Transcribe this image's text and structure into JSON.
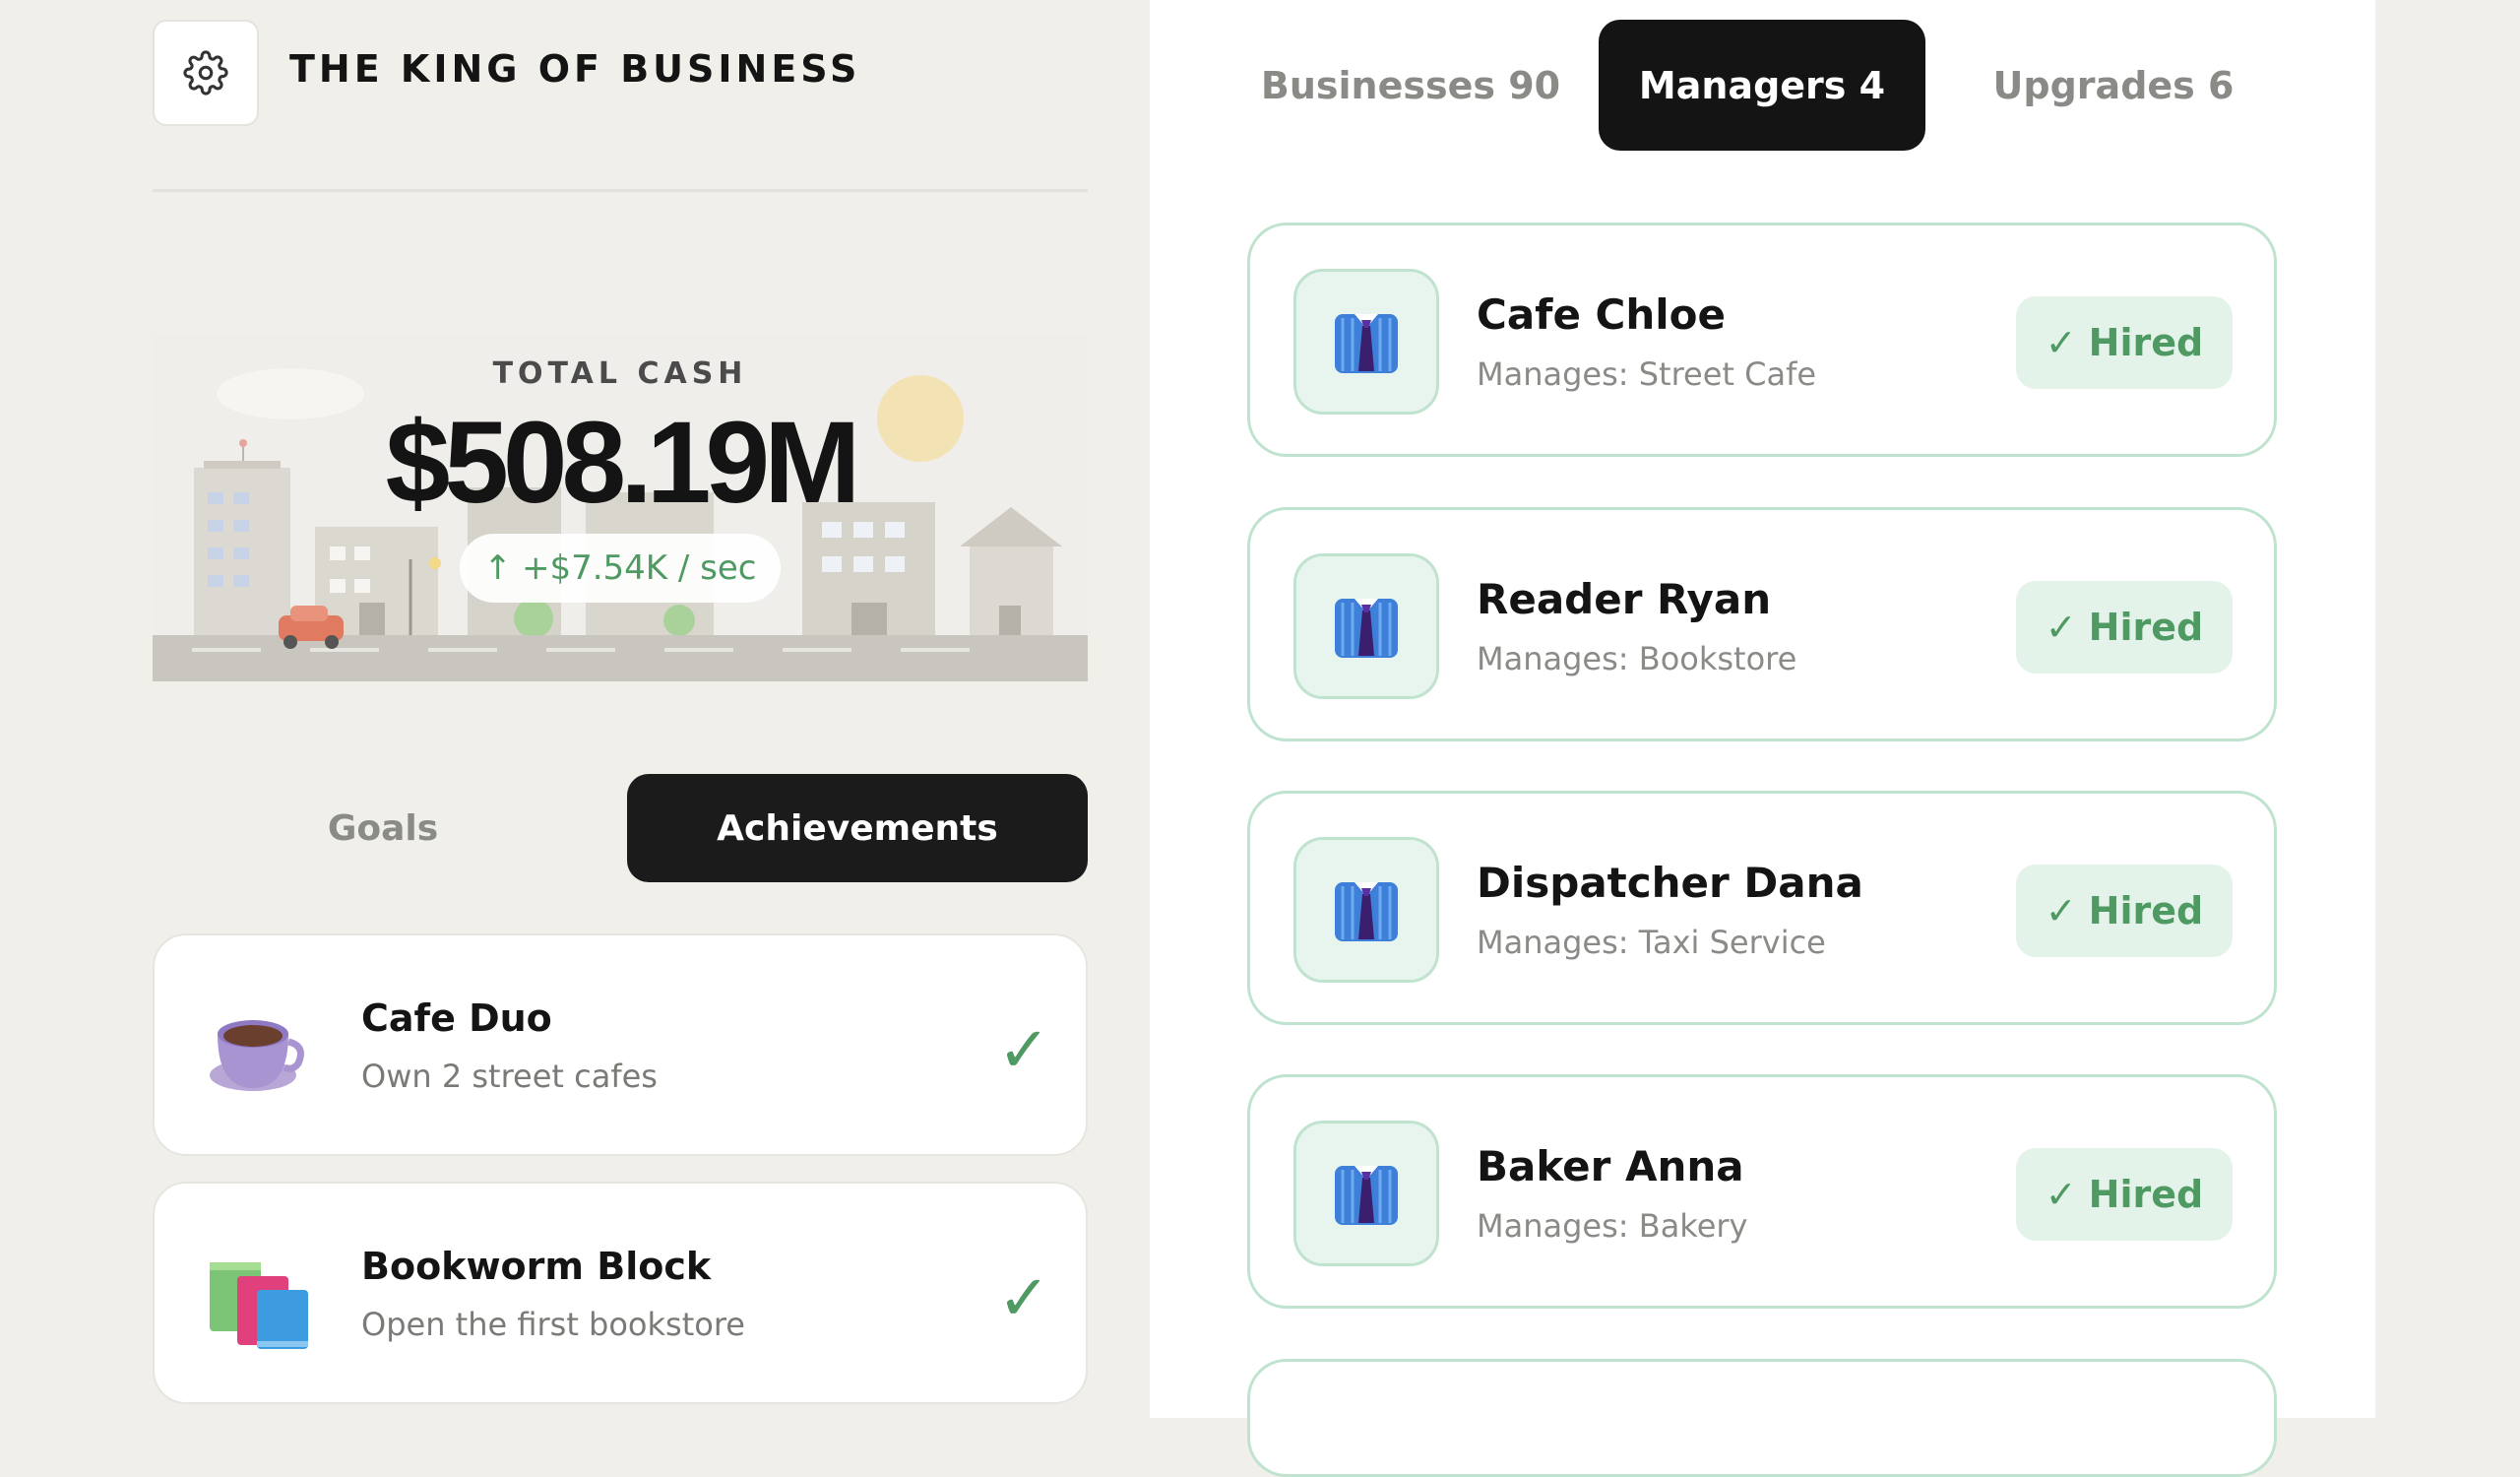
{
  "header": {
    "app_title": "THE KING OF BUSINESS",
    "settings_icon": "gear-icon"
  },
  "hero": {
    "cash_label": "TOTAL CASH",
    "cash_value": "$508.19M",
    "rate_arrow": "↑",
    "rate_text": "+$7.54K / sec"
  },
  "left_tabs": {
    "goals": "Goals",
    "achievements": "Achievements",
    "active": "achievements"
  },
  "achievements": [
    {
      "title": "Cafe Duo",
      "desc": "Own 2 street cafes",
      "icon": "coffee-cup-icon",
      "check": "✓"
    },
    {
      "title": "Bookworm Block",
      "desc": "Open the first bookstore",
      "icon": "books-icon",
      "check": "✓"
    }
  ],
  "right_tabs": {
    "businesses": "Businesses 90",
    "managers": "Managers 4",
    "upgrades": "Upgrades 6",
    "active": "managers"
  },
  "managers": [
    {
      "name": "Cafe Chloe",
      "manages": "Manages: Street Cafe",
      "status": "Hired",
      "check": "✓",
      "icon": "suit-shirt-icon"
    },
    {
      "name": "Reader Ryan",
      "manages": "Manages: Bookstore",
      "status": "Hired",
      "check": "✓",
      "icon": "suit-shirt-icon"
    },
    {
      "name": "Dispatcher Dana",
      "manages": "Manages: Taxi Service",
      "status": "Hired",
      "check": "✓",
      "icon": "suit-shirt-icon"
    },
    {
      "name": "Baker Anna",
      "manages": "Manages: Bakery",
      "status": "Hired",
      "check": "✓",
      "icon": "suit-shirt-icon"
    }
  ],
  "colors": {
    "background": "#f0efea",
    "panel": "#ffffff",
    "accent_dark": "#141414",
    "success_green": "#4f9a63",
    "card_border_green": "#bfe3cf",
    "badge_green_bg": "#e4f3ea"
  }
}
